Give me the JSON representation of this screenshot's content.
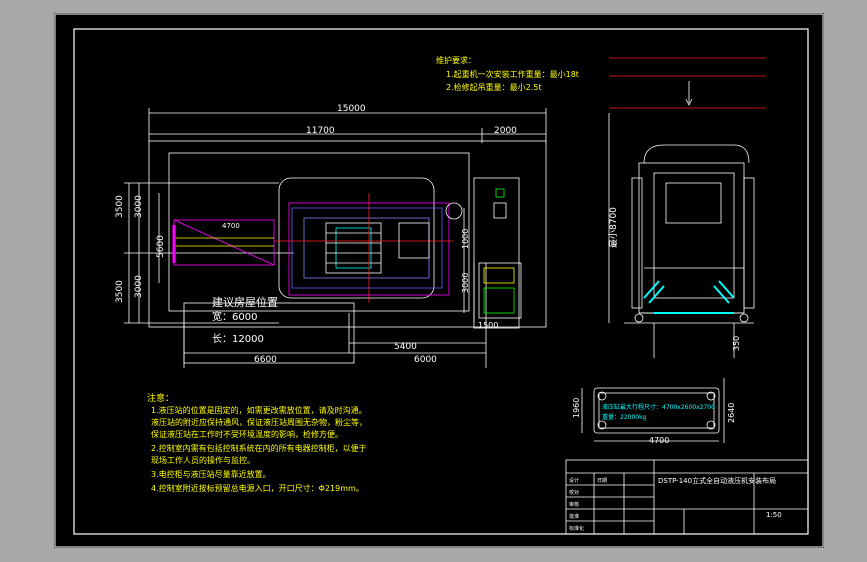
{
  "colors": {
    "background": "#a9a9a9",
    "sheet": "#000000",
    "line": "#ffffff",
    "note": "#ffff00",
    "dim": "#00ffff",
    "magenta": "#ff00ff",
    "red": "#ff2020"
  },
  "dims": {
    "total_width": "15000",
    "inner_width": "11700",
    "right_width": "2000",
    "left_3500": "3500",
    "left_3000_top": "3000",
    "left_3000_bottom": "3000",
    "left_3500_bottom": "3500",
    "height_5600": "5600",
    "dim_4700": "4700",
    "right_1000": "1000",
    "right_3000": "3000",
    "small_1500": "1500",
    "bottom_5400": "5400",
    "bottom_6000": "6000",
    "bottom_6600": "6600",
    "side_height": "最小8700",
    "side_350": "350",
    "bottom_1960": "1960",
    "bottom_2640": "2640",
    "bottom_4700": "4700"
  },
  "room": {
    "title": "建议房屋位置",
    "width": "宽：6000",
    "length": "长：12000"
  },
  "hoist": {
    "title": "维护要求：",
    "line1": "1.起重机一次安装工作重量：最小18t",
    "line2": "2.检修起吊重量：最小2.5t"
  },
  "notes": {
    "title": "注意：",
    "lines": [
      "1.液压站的位置是固定的，如需更改需放位置，请及时沟通。",
      "   液压站的附近应保持通风，保证液压站周围无杂物，粉尘等，",
      "   保证液压站在工作时不受环境温度的影响，检修方便。",
      "2.控制室内需有包括控制系统在内的所有电器控制柜，以便于",
      "   现场工作人员的操作与监控。",
      "3.电控柜与液压站尽量靠近放置。",
      "4.控制室附近按标预留总电源入口，开口尺寸：Φ219mm。"
    ]
  },
  "bottom_view": {
    "line1": "液压缸最大行程尺寸：4700x2600x2700",
    "line2": "重量：22000kg"
  },
  "title_block": {
    "drawing_title": "DSTP-140立式全自动液压机安装布局",
    "scale": "1:50",
    "labels": [
      "设计",
      "校对",
      "审核",
      "批准",
      "标准化",
      "日期"
    ]
  }
}
